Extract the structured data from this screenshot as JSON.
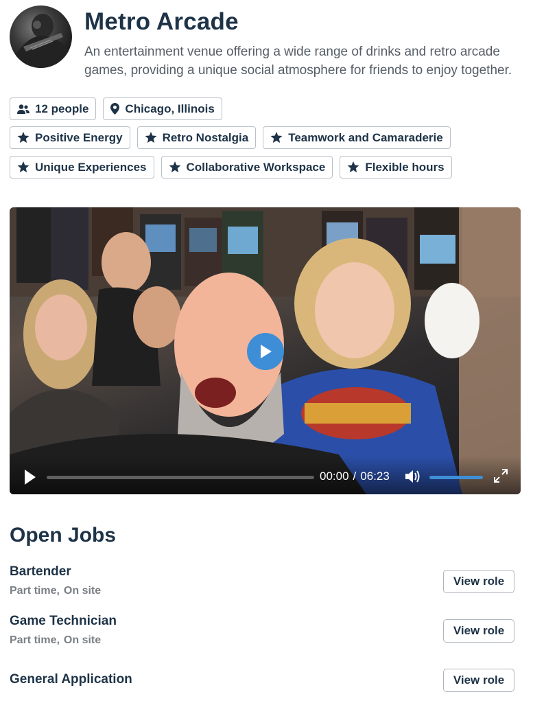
{
  "company": {
    "name": "Metro Arcade",
    "description": "An entertainment venue offering a wide range of drinks and retro arcade games, providing a unique social atmosphere for friends to enjoy together."
  },
  "info_tags": [
    {
      "icon": "people-icon",
      "label": "12 people"
    },
    {
      "icon": "location-pin-icon",
      "label": "Chicago, Illinois"
    }
  ],
  "value_tags": [
    {
      "icon": "star-icon",
      "label": "Positive Energy"
    },
    {
      "icon": "star-icon",
      "label": "Retro Nostalgia"
    },
    {
      "icon": "star-icon",
      "label": "Teamwork and Camaraderie"
    },
    {
      "icon": "star-icon",
      "label": "Unique Experiences"
    },
    {
      "icon": "star-icon",
      "label": "Collaborative Workspace"
    },
    {
      "icon": "star-icon",
      "label": "Flexible hours"
    }
  ],
  "video": {
    "current_time": "00:00",
    "separator": "/",
    "duration": "06:23",
    "progress": 0,
    "volume": 1.0,
    "accent_color": "#3d8ed6"
  },
  "jobs": {
    "heading": "Open Jobs",
    "button_label": "View role",
    "items": [
      {
        "title": "Bartender",
        "type": "Part time,",
        "location": "On site"
      },
      {
        "title": "Game Technician",
        "type": "Part time,",
        "location": "On site"
      },
      {
        "title": "General Application",
        "type": "",
        "location": ""
      }
    ]
  },
  "colors": {
    "heading": "#1e3347",
    "muted": "#7a7f85",
    "border": "#b9c0c7"
  }
}
